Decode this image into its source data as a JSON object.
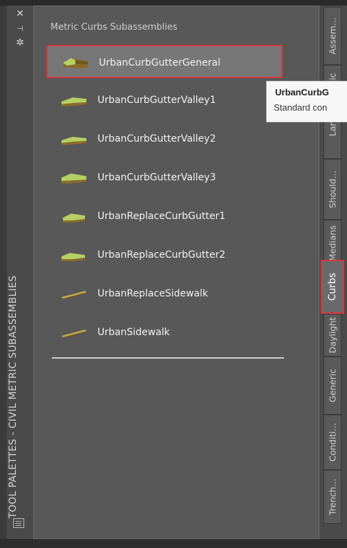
{
  "window": {
    "vertical_title": "TOOL PALETTES - CIVIL METRIC SUBASSEMBLIES",
    "icons": [
      "close-icon",
      "auto-hide-icon",
      "properties-icon"
    ]
  },
  "palette": {
    "group_title": "Metric Curbs Subassemblies",
    "items": [
      {
        "label": "UrbanCurbGutterGeneral",
        "selected": true
      },
      {
        "label": "UrbanCurbGutterValley1",
        "selected": false
      },
      {
        "label": "UrbanCurbGutterValley2",
        "selected": false
      },
      {
        "label": "UrbanCurbGutterValley3",
        "selected": false
      },
      {
        "label": "UrbanReplaceCurbGutter1",
        "selected": false
      },
      {
        "label": "UrbanReplaceCurbGutter2",
        "selected": false
      },
      {
        "label": "UrbanReplaceSidewalk",
        "selected": false
      },
      {
        "label": "UrbanSidewalk",
        "selected": false
      }
    ]
  },
  "tooltip": {
    "title": "UrbanCurbG",
    "text": "Standard con"
  },
  "tabs": [
    {
      "label": "Assem..."
    },
    {
      "label": "sic"
    },
    {
      "label": "Lane"
    },
    {
      "label": "Should..."
    },
    {
      "label": "Medians"
    },
    {
      "label": "Curbs",
      "active": true
    },
    {
      "label": "Daylight"
    },
    {
      "label": "Generic"
    },
    {
      "label": "Conditi..."
    },
    {
      "label": "Trench..."
    }
  ],
  "colors": {
    "highlight_border": "#d9363e",
    "panel_bg": "#585858",
    "icon_green": "#b5cf63",
    "icon_brown": "#8a6b2a"
  }
}
